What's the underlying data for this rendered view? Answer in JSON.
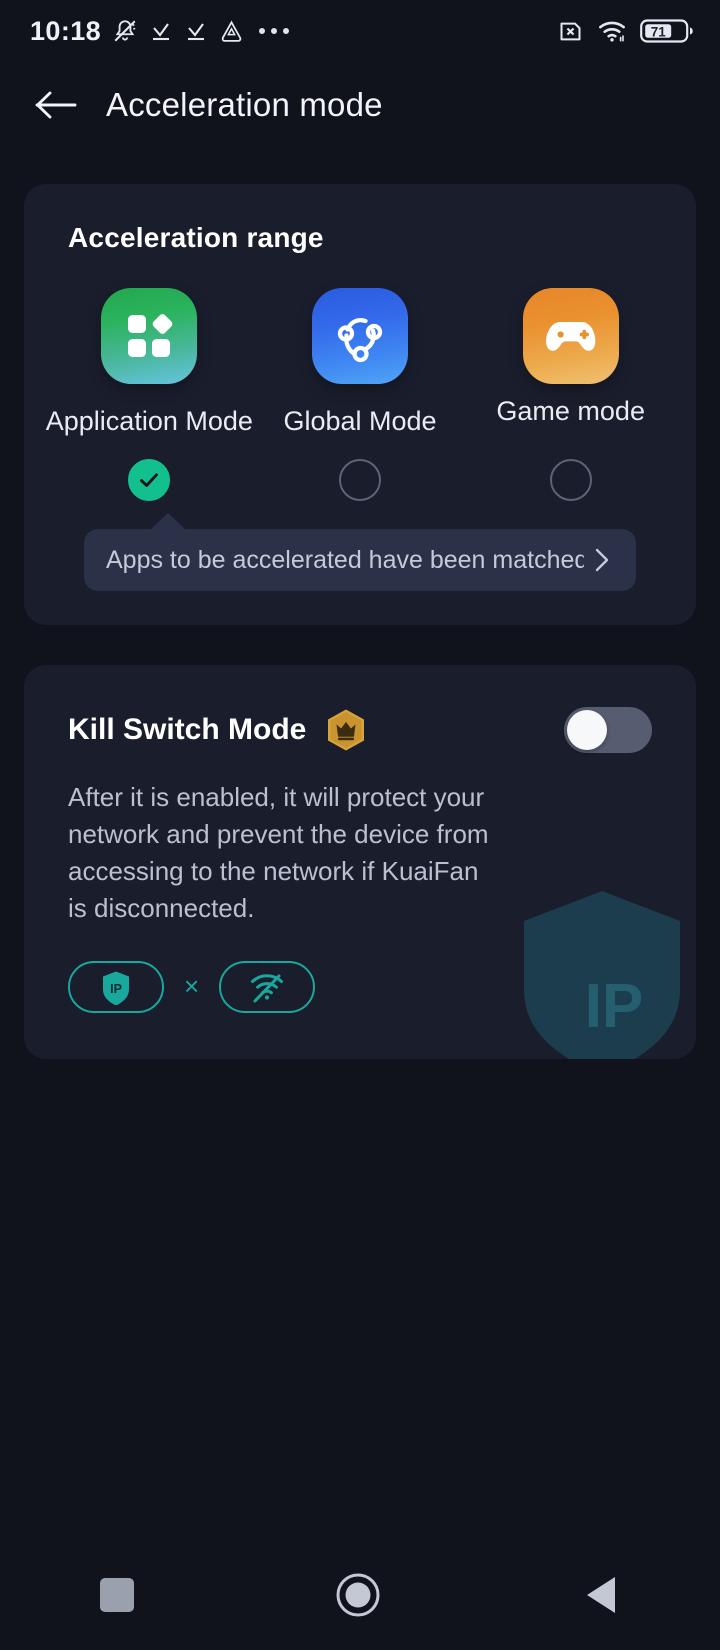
{
  "status_bar": {
    "time": "10:18",
    "battery_level": "71",
    "icons": [
      "bell-mute-icon",
      "download-check-icon",
      "download-check-icon",
      "alipay-triangle-icon",
      "overflow-dots-icon",
      "sim-card-disabled-icon",
      "wifi-icon",
      "battery-icon"
    ]
  },
  "header": {
    "back_label": "back-arrow-icon",
    "title": "Acceleration mode"
  },
  "acceleration_range": {
    "title": "Acceleration range",
    "modes": [
      {
        "label": "Application Mode",
        "icon": "apps-grid-icon",
        "selected": true
      },
      {
        "label": "Global Mode",
        "icon": "network-nodes-icon",
        "selected": false
      },
      {
        "label": "Game mode",
        "icon": "gamepad-icon",
        "selected": false
      }
    ],
    "tooltip": {
      "text": "Apps to be accelerated have been matched.Modi",
      "chevron": "chevron-right-icon"
    }
  },
  "kill_switch": {
    "title": "Kill Switch Mode",
    "badge": "crown-premium-icon",
    "toggle_state": "off",
    "description": "After it is enabled, it will protect your network and prevent the device from accessing to the network if KuaiFan is disconnected.",
    "chips": [
      {
        "icon": "ip-shield-icon"
      },
      {
        "icon": "wifi-slash-icon"
      }
    ],
    "chip_separator": "×",
    "watermark_text": "IP"
  },
  "nav_bar": {
    "items": [
      "recents-square-icon",
      "home-circle-icon",
      "back-triangle-icon"
    ]
  },
  "colors": {
    "background": "#10121c",
    "card": "#1a1d2c",
    "accent_teal": "#12c08e",
    "chip_teal": "#18a89d",
    "tooltip": "#2b3148",
    "badge_gold": "#d9a33c"
  }
}
